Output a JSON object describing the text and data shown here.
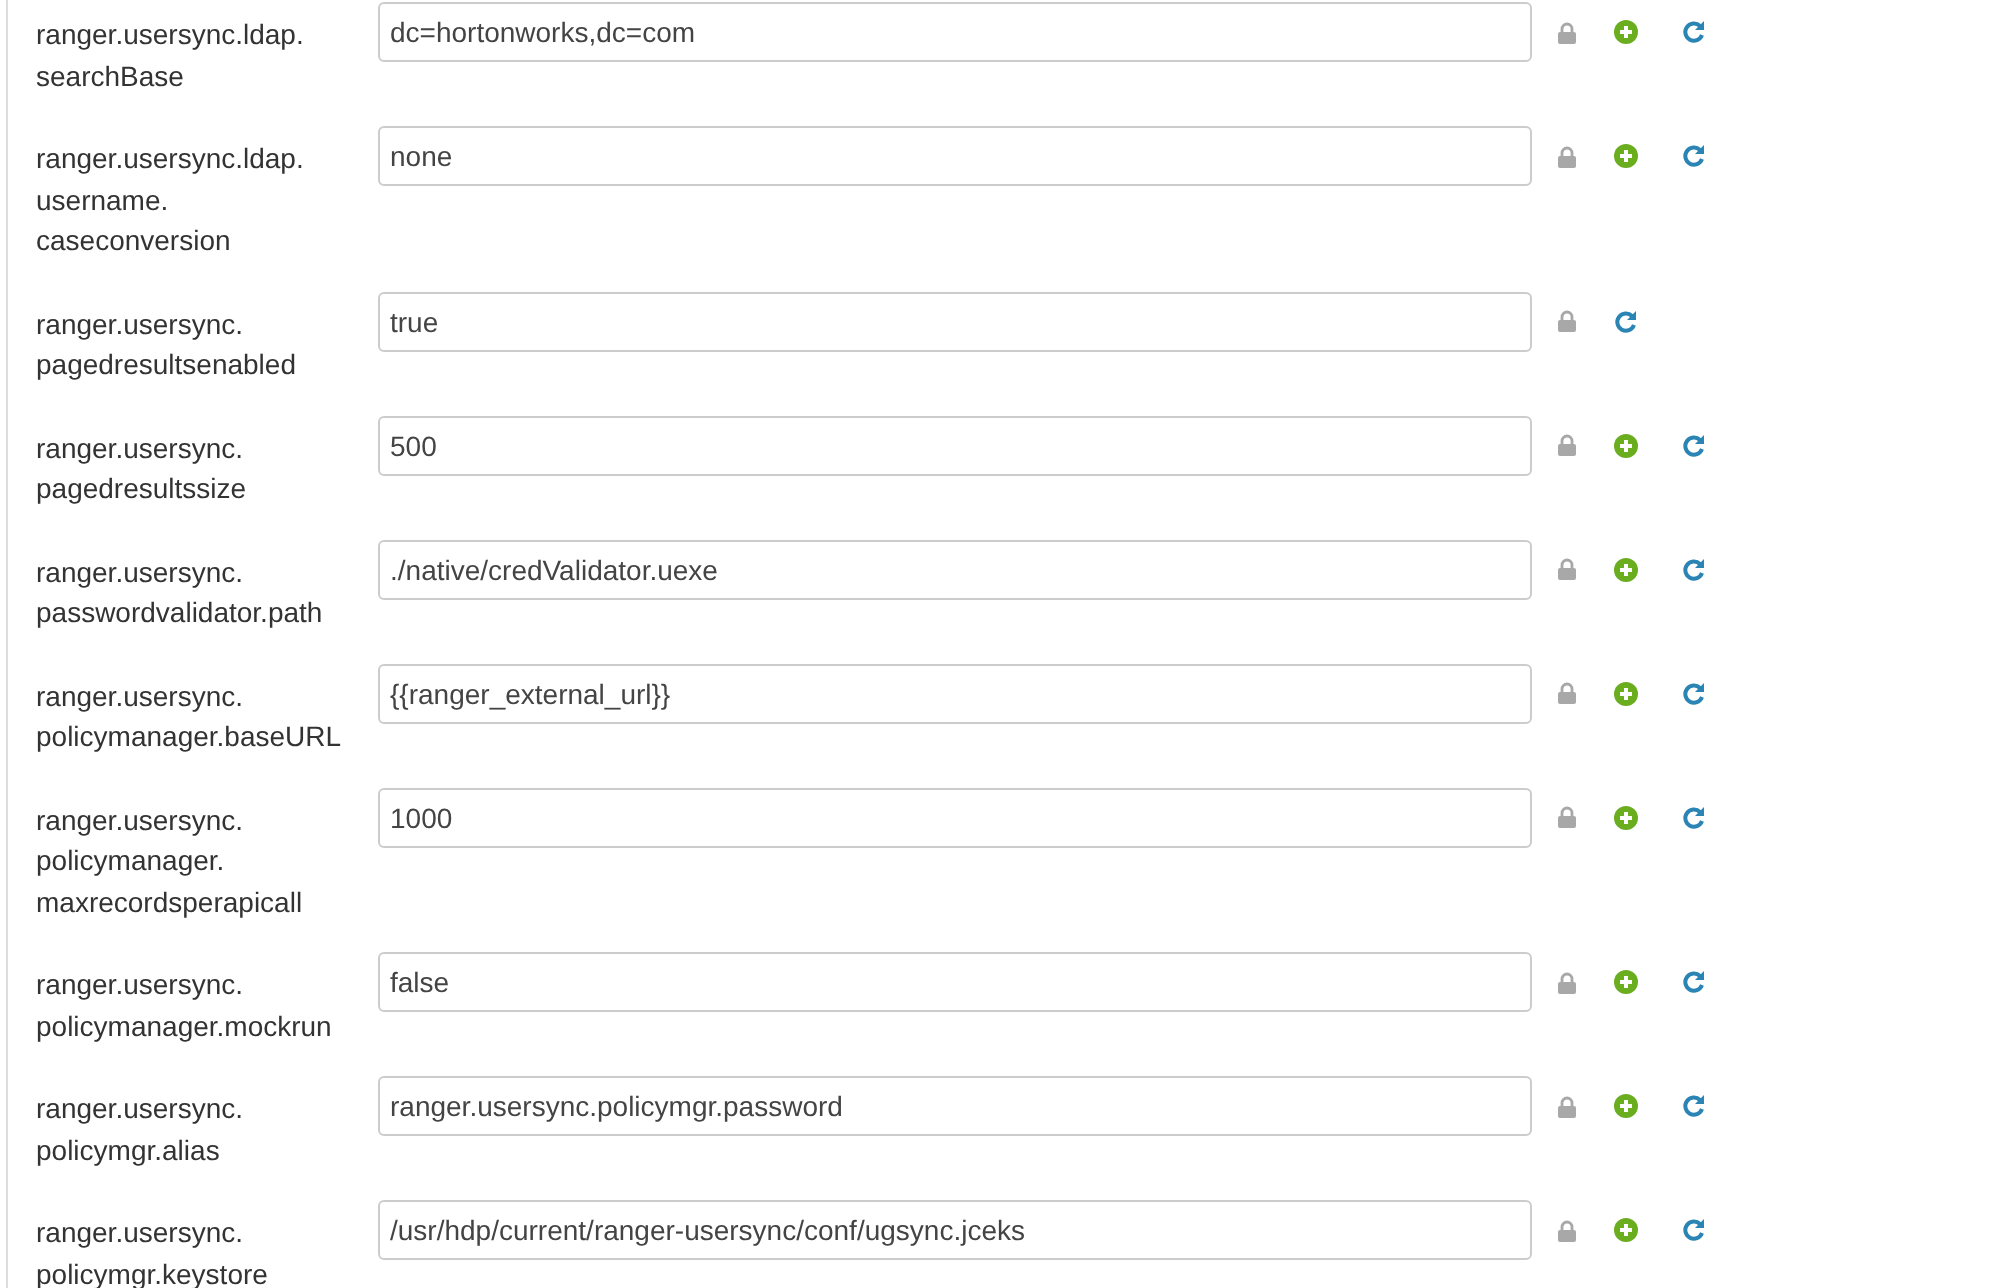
{
  "properties": [
    {
      "label_lines": [
        "ranger.usersync.ldap.",
        "searchBase"
      ],
      "value": "dc=hortonworks,dc=com",
      "can_override": true
    },
    {
      "label_lines": [
        "ranger.usersync.ldap.",
        "username.",
        "caseconversion"
      ],
      "value": "none",
      "can_override": true
    },
    {
      "label_lines": [
        "ranger.usersync.",
        "pagedresultsenabled"
      ],
      "value": "true",
      "can_override": false
    },
    {
      "label_lines": [
        "ranger.usersync.",
        "pagedresultssize"
      ],
      "value": "500",
      "can_override": true
    },
    {
      "label_lines": [
        "ranger.usersync.",
        "passwordvalidator.path"
      ],
      "value": "./native/credValidator.uexe",
      "can_override": true
    },
    {
      "label_lines": [
        "ranger.usersync.",
        "policymanager.baseURL"
      ],
      "value": "{{ranger_external_url}}",
      "can_override": true
    },
    {
      "label_lines": [
        "ranger.usersync.",
        "policymanager.",
        "maxrecordsperapicall"
      ],
      "value": "1000",
      "can_override": true
    },
    {
      "label_lines": [
        "ranger.usersync.",
        "policymanager.mockrun"
      ],
      "value": "false",
      "can_override": true
    },
    {
      "label_lines": [
        "ranger.usersync.",
        "policymgr.alias"
      ],
      "value": "ranger.usersync.policymgr.password",
      "can_override": true
    },
    {
      "label_lines": [
        "ranger.usersync.",
        "policymgr.keystore"
      ],
      "value": "/usr/hdp/current/ranger-usersync/conf/ugsync.jceks",
      "can_override": true
    }
  ]
}
